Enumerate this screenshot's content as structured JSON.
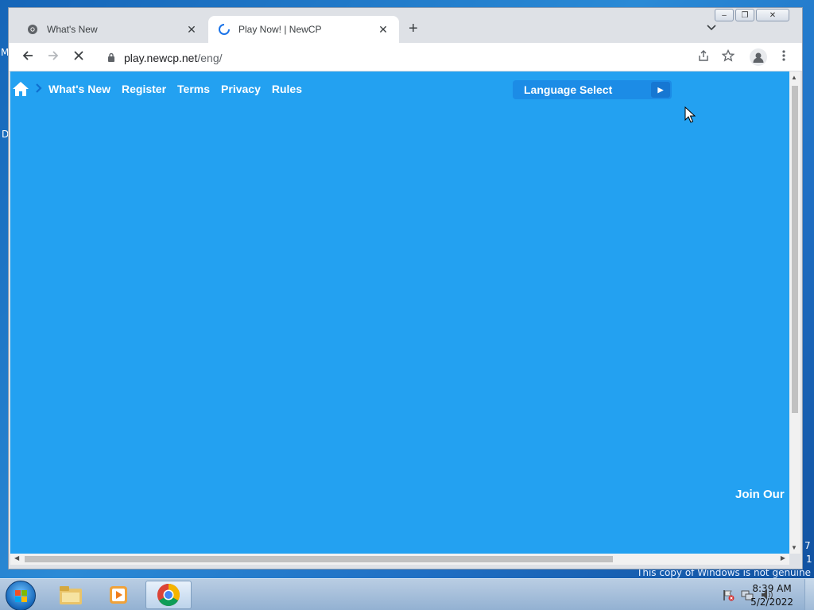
{
  "desktop": {
    "watermark": "This copy of Windows is not genuine",
    "edge_glyphs": [
      "M",
      "D"
    ],
    "right_glyphs": [
      "7",
      "1"
    ]
  },
  "browser": {
    "window_controls": [
      "minimize",
      "restore",
      "close"
    ],
    "tabs": [
      {
        "title": "What's New",
        "icon": "chrome-favicon-icon",
        "active": false
      },
      {
        "title": "Play Now! | NewCP",
        "icon": "loading-spinner-icon",
        "active": true
      }
    ],
    "newtab_glyph": "+",
    "url_host": "play.newcp.net",
    "url_path": "/eng/"
  },
  "page": {
    "nav": [
      "What's New",
      "Register",
      "Terms",
      "Privacy",
      "Rules"
    ],
    "language_select": "Language Select",
    "join_text": "Join Our",
    "background_color": "#23a1f1"
  },
  "taskbar": {
    "time": "8:39 AM",
    "date": "5/2/2022",
    "apps": [
      "file-explorer-icon",
      "media-player-icon",
      "chrome-icon"
    ]
  }
}
